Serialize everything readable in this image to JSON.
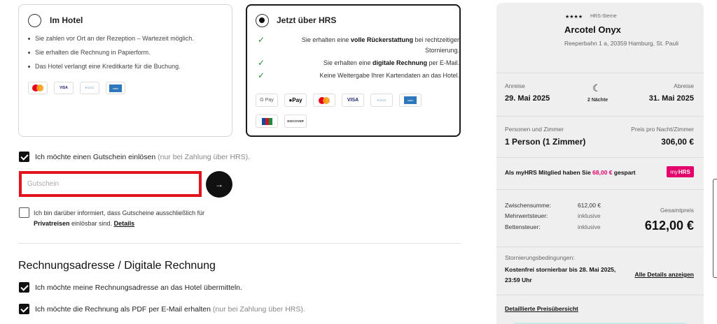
{
  "payment": {
    "hotel": {
      "title": "Im Hotel",
      "bullets": [
        "Sie zahlen vor Ort an der Rezeption – Wartezeit möglich.",
        "Sie erhalten die Rechnung in Papierform.",
        "Das Hotel verlangt eine Kreditkarte für die Buchung."
      ],
      "methods": [
        "mastercard-icon",
        "visa-icon",
        "bank-icon",
        "amex-icon"
      ],
      "visa_text": "VISA"
    },
    "hrs": {
      "title": "Jetzt über HRS",
      "check1_pre": "Sie erhalten eine ",
      "check1_bold": "volle Rückerstattung",
      "check1_post": " bei rechtzeitiger Stornierung.",
      "check2_pre": "Sie erhalten eine ",
      "check2_bold": "digitale Rechnung",
      "check2_post": " per E-Mail.",
      "check3": "Keine Weitergabe Ihrer Kartendaten an das Hotel.",
      "gpay": "G Pay",
      "apay": "Pay",
      "visa": "VISA",
      "jcb": "JCB",
      "discover": "DISCOVER"
    }
  },
  "voucher": {
    "checkbox_label": "Ich möchte einen Gutschein einlösen",
    "checkbox_note": "(nur bei Zahlung über HRS).",
    "placeholder": "Gutschein",
    "submit_arrow": "→",
    "private_pre": "Ich bin darüber informiert, dass Gutscheine ausschließlich für",
    "private_bold": "Privatreisen",
    "private_post": " einlösbar sind. ",
    "details_link": "Details"
  },
  "billing": {
    "title": "Rechnungsadresse / Digitale Rechnung",
    "option1": "Ich möchte meine Rechnungsadresse an das Hotel übermitteln.",
    "option2_label": "Ich möchte die Rechnung als PDF per E-Mail erhalten",
    "option2_note": "(nur bei Zahlung über HRS)."
  },
  "summary": {
    "stars": "★★★★",
    "stars_label": "HRS-Sterne",
    "hotel_name": "Arcotel Onyx",
    "address": "Reeperbahn 1 a, 20359 Hamburg, St. Pauli",
    "arrival_label": "Anreise",
    "arrival_date": "29. Mai 2025",
    "departure_label": "Abreise",
    "departure_date": "31. Mai 2025",
    "moon_icon": "☾",
    "nights": "2 Nächte",
    "guests_label": "Personen und Zimmer",
    "guests_value": "1 Person (1 Zimmer)",
    "price_label": "Preis pro Nacht/Zimmer",
    "price_value": "306,00 €",
    "myhrs_pre": "Als myHRS Mitglied haben Sie ",
    "myhrs_amount": "68,00 €",
    "myhrs_post": " gespart",
    "badge_my": "my",
    "badge_hrs": "HRS",
    "subtotal_label": "Zwischensumme:",
    "subtotal_value": "612,00 €",
    "vat_label": "Mehrwertsteuer:",
    "vat_value": "inklusive",
    "bedtax_label": "Bettensteuer:",
    "bedtax_value": "inklusive",
    "total_label": "Gesamtpreis",
    "total_value": "612,00 €",
    "cancel_label": "Stornierungsbedingungen:",
    "cancel_text": "Kostenfrei stornierbar bis 28. Mai 2025, 23:59 Uhr",
    "cancel_link": "Alle Details anzeigen",
    "price_overview_link": "Detaillierte Preisübersicht"
  },
  "colors": {
    "accent_red": "#e3131d",
    "myhrs_pink": "#e3006a",
    "check_green": "#2e8b3a"
  }
}
